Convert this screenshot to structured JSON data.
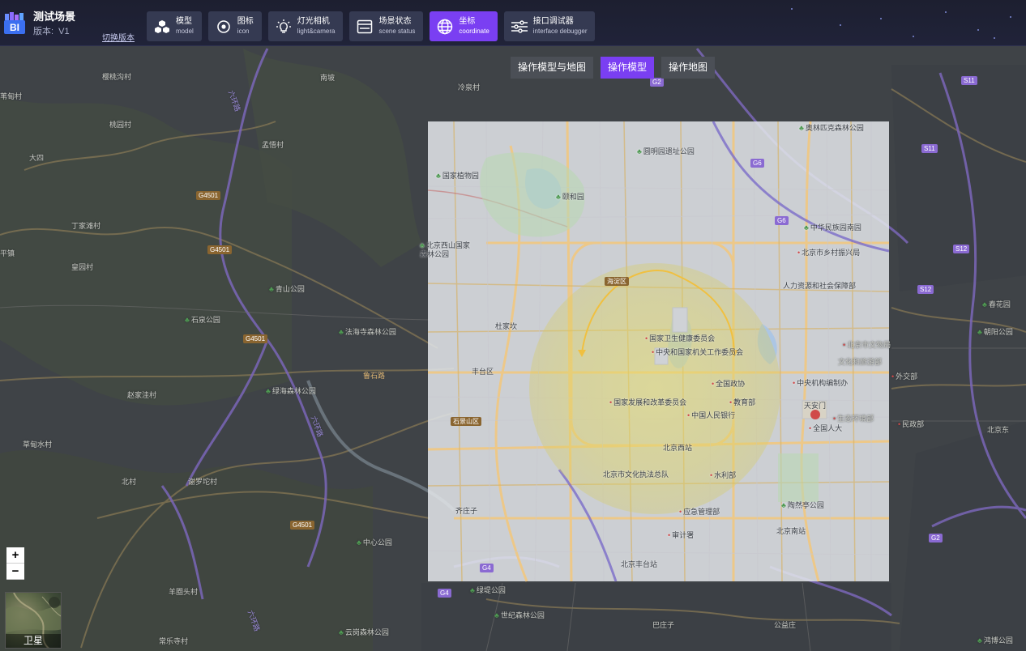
{
  "header": {
    "title": "测试场景",
    "logo_text": "BI",
    "version_label": "版本:",
    "version_value": "V1",
    "switch_version": "切换版本"
  },
  "nav": [
    {
      "zh": "模型",
      "en": "model",
      "icon": "cube-cluster-icon",
      "active": false
    },
    {
      "zh": "图标",
      "en": "icon",
      "icon": "map-pin-icon",
      "active": false
    },
    {
      "zh": "灯光相机",
      "en": "light&camera",
      "icon": "lightbulb-icon",
      "active": false
    },
    {
      "zh": "场景状态",
      "en": "scene status",
      "icon": "window-icon",
      "active": false
    },
    {
      "zh": "坐标",
      "en": "coordinate",
      "icon": "globe-icon",
      "active": true
    },
    {
      "zh": "接口调试器",
      "en": "interface debugger",
      "icon": "sliders-icon",
      "active": false
    }
  ],
  "mode_toggle": {
    "options": [
      "操作模型与地图",
      "操作模型",
      "操作地图"
    ],
    "selected": "操作模型"
  },
  "zoom": {
    "in": "+",
    "out": "−"
  },
  "basemap": {
    "label": "卫星"
  },
  "colors": {
    "accent": "#7a3ff2",
    "topbar": "#1f2236",
    "nav_item": "#353a52",
    "arc": "#f0c040"
  },
  "map_labels": {
    "outside": [
      "樱桃沟村",
      "苇甸村",
      "南坡",
      "冷泉村",
      "桃园村",
      "大四",
      "孟悟村",
      "丁家滩村",
      "平镇",
      "皇园村",
      "青山公园",
      "石泉公园",
      "法海寺森林公园",
      "赵家洼村",
      "绿海森林公园",
      "草甸水村",
      "北村",
      "谢罗坨村",
      "中心公园",
      "羊圈头村",
      "常乐寺村",
      "云岗森林公园",
      "世纪森林公园",
      "绿堤公园",
      "巴庄子",
      "公益庄",
      "鸿博公园",
      "春花园",
      "朝阳公园",
      "北京东",
      "外交部",
      "民政部",
      "北京市文物局",
      "文化和旅游部",
      "中央机构编制办",
      "生态环境部",
      "奥林匹克森林公园",
      "中华民族园南园",
      "北京市乡村振兴局",
      "人力资源和社会保障部"
    ],
    "inside": [
      "国家植物园",
      "圆明园遗址公园",
      "颐和园",
      "北京西山国家森林公园",
      "海淀区",
      "杜家坎",
      "国家卫生健康委员会",
      "中央和国家机关工作委员会",
      "全国政协",
      "国家发展和改革委员会",
      "教育部",
      "天安门",
      "中国人民银行",
      "全国人大",
      "北京西站",
      "北京市文化执法总队",
      "水利部",
      "石景山区",
      "鲁石路",
      "丰台区",
      "齐庄子",
      "应急管理部",
      "审计署",
      "北京南站",
      "北京丰台站",
      "陶然亭公园"
    ],
    "roads": [
      "G4501",
      "G4501",
      "G4501",
      "G4501",
      "G6",
      "G6",
      "S11",
      "S11",
      "S12",
      "S12",
      "G2",
      "G4",
      "G4",
      "G2",
      "六环路",
      "六环路",
      "六环路"
    ]
  }
}
